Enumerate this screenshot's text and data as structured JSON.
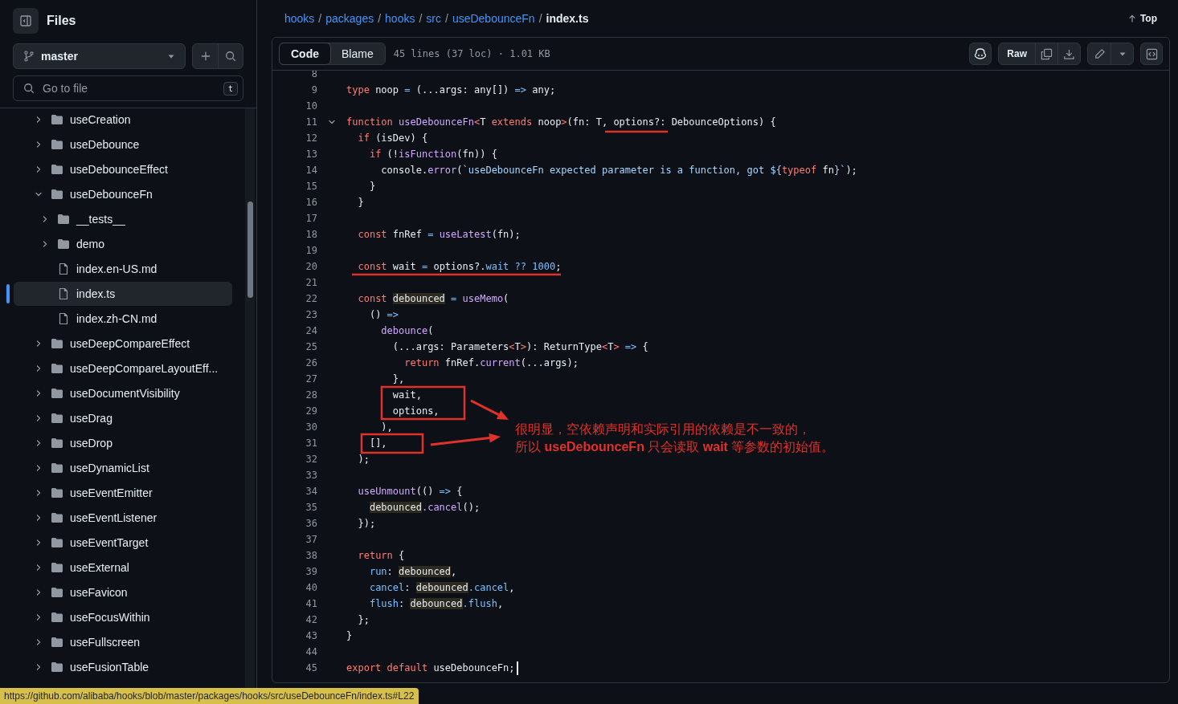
{
  "sidebar": {
    "title": "Files",
    "branch": "master",
    "search": {
      "placeholder": "Go to file",
      "shortcut": "t"
    },
    "tree": [
      {
        "label": "useCreation",
        "kind": "folder",
        "expanded": false,
        "selected": false
      },
      {
        "label": "useDebounce",
        "kind": "folder",
        "expanded": false,
        "selected": false
      },
      {
        "label": "useDebounceEffect",
        "kind": "folder",
        "expanded": false,
        "selected": false
      },
      {
        "label": "useDebounceFn",
        "kind": "folder",
        "expanded": true,
        "selected": false,
        "children": [
          {
            "label": "__tests__",
            "kind": "folder",
            "expanded": false,
            "selected": false
          },
          {
            "label": "demo",
            "kind": "folder",
            "expanded": false,
            "selected": false
          },
          {
            "label": "index.en-US.md",
            "kind": "file",
            "selected": false
          },
          {
            "label": "index.ts",
            "kind": "file",
            "selected": true
          },
          {
            "label": "index.zh-CN.md",
            "kind": "file",
            "selected": false
          }
        ]
      },
      {
        "label": "useDeepCompareEffect",
        "kind": "folder",
        "expanded": false,
        "selected": false
      },
      {
        "label": "useDeepCompareLayoutEff...",
        "kind": "folder",
        "expanded": false,
        "selected": false
      },
      {
        "label": "useDocumentVisibility",
        "kind": "folder",
        "expanded": false,
        "selected": false
      },
      {
        "label": "useDrag",
        "kind": "folder",
        "expanded": false,
        "selected": false
      },
      {
        "label": "useDrop",
        "kind": "folder",
        "expanded": false,
        "selected": false
      },
      {
        "label": "useDynamicList",
        "kind": "folder",
        "expanded": false,
        "selected": false
      },
      {
        "label": "useEventEmitter",
        "kind": "folder",
        "expanded": false,
        "selected": false
      },
      {
        "label": "useEventListener",
        "kind": "folder",
        "expanded": false,
        "selected": false
      },
      {
        "label": "useEventTarget",
        "kind": "folder",
        "expanded": false,
        "selected": false
      },
      {
        "label": "useExternal",
        "kind": "folder",
        "expanded": false,
        "selected": false
      },
      {
        "label": "useFavicon",
        "kind": "folder",
        "expanded": false,
        "selected": false
      },
      {
        "label": "useFocusWithin",
        "kind": "folder",
        "expanded": false,
        "selected": false
      },
      {
        "label": "useFullscreen",
        "kind": "folder",
        "expanded": false,
        "selected": false
      },
      {
        "label": "useFusionTable",
        "kind": "folder",
        "expanded": false,
        "selected": false
      }
    ]
  },
  "breadcrumb": [
    {
      "label": "hooks",
      "separator": "/"
    },
    {
      "label": "packages",
      "separator": "/"
    },
    {
      "label": "hooks",
      "separator": "/"
    },
    {
      "label": "src",
      "separator": "/"
    },
    {
      "label": "useDebounceFn",
      "separator": "/"
    },
    {
      "label": "index.ts"
    }
  ],
  "top_link": "Top",
  "toolbar": {
    "tabs": [
      {
        "label": "Code",
        "selected": true
      },
      {
        "label": "Blame",
        "selected": false
      }
    ],
    "file_info": "45 lines (37 loc) · 1.01 KB",
    "raw": "Raw"
  },
  "code": [
    {
      "n": "8"
    },
    {
      "n": "9",
      "tokens": [
        {
          "text": "type",
          "kind": "k"
        },
        {
          "text": " noop ",
          "kind": "p"
        },
        {
          "text": "=",
          "kind": "c"
        },
        {
          "text": " (...args: any[]) ",
          "kind": "p"
        },
        {
          "text": "=>",
          "kind": "c"
        },
        {
          "text": " any;",
          "kind": "p"
        }
      ]
    },
    {
      "n": "10"
    },
    {
      "n": "11",
      "fold": true,
      "tokens": [
        {
          "text": "function",
          "kind": "k"
        },
        {
          "text": " useDebounceFn",
          "kind": "f"
        },
        {
          "text": "<",
          "kind": "k"
        },
        {
          "text": "T ",
          "kind": "p"
        },
        {
          "text": "extends",
          "kind": "k"
        },
        {
          "text": " noop",
          "kind": "p"
        },
        {
          "text": ">",
          "kind": "k"
        },
        {
          "text": "(fn: T, options?: DebounceOptions) {",
          "kind": "p"
        }
      ]
    },
    {
      "n": "12",
      "tokens": [
        {
          "text": "  if",
          "kind": "k"
        },
        {
          "text": " (isDev) {",
          "kind": "p"
        }
      ]
    },
    {
      "n": "13",
      "tokens": [
        {
          "text": "    if",
          "kind": "k"
        },
        {
          "text": " (!",
          "kind": "p"
        },
        {
          "text": "isFunction",
          "kind": "f"
        },
        {
          "text": "(fn)) {",
          "kind": "p"
        }
      ]
    },
    {
      "n": "14",
      "tokens": [
        {
          "text": "      console.",
          "kind": "p"
        },
        {
          "text": "error",
          "kind": "f"
        },
        {
          "text": "(",
          "kind": "p"
        },
        {
          "text": "`useDebounceFn expected parameter is a function, got ${",
          "kind": "s"
        },
        {
          "text": "typeof",
          "kind": "k"
        },
        {
          "text": " fn",
          "kind": "p"
        },
        {
          "text": "}`",
          "kind": "s"
        },
        {
          "text": ");",
          "kind": "p"
        }
      ]
    },
    {
      "n": "15",
      "tokens": [
        {
          "text": "    }",
          "kind": "p"
        }
      ]
    },
    {
      "n": "16",
      "tokens": [
        {
          "text": "  }",
          "kind": "p"
        }
      ]
    },
    {
      "n": "17"
    },
    {
      "n": "18",
      "tokens": [
        {
          "text": "  const",
          "kind": "k"
        },
        {
          "text": " fnRef ",
          "kind": "p"
        },
        {
          "text": "=",
          "kind": "c"
        },
        {
          "text": " useLatest",
          "kind": "f"
        },
        {
          "text": "(fn);",
          "kind": "p"
        }
      ]
    },
    {
      "n": "19"
    },
    {
      "n": "20",
      "tokens": [
        {
          "text": "  const",
          "kind": "k"
        },
        {
          "text": " wait ",
          "kind": "p"
        },
        {
          "text": "=",
          "kind": "c"
        },
        {
          "text": " options?.",
          "kind": "p"
        },
        {
          "text": "wait ?? 1000",
          "kind": "c"
        },
        {
          "text": ";",
          "kind": "p"
        }
      ]
    },
    {
      "n": "21"
    },
    {
      "n": "22",
      "tokens": [
        {
          "text": "  const ",
          "kind": "k"
        },
        {
          "text": "debounced",
          "kind": "h"
        },
        {
          "text": " = ",
          "kind": "c"
        },
        {
          "text": "useMemo",
          "kind": "f"
        },
        {
          "text": "(",
          "kind": "p"
        }
      ]
    },
    {
      "n": "23",
      "tokens": [
        {
          "text": "    () ",
          "kind": "p"
        },
        {
          "text": "=>",
          "kind": "c"
        }
      ]
    },
    {
      "n": "24",
      "tokens": [
        {
          "text": "      debounce",
          "kind": "f"
        },
        {
          "text": "(",
          "kind": "p"
        }
      ]
    },
    {
      "n": "25",
      "tokens": [
        {
          "text": "        (...args: Parameters",
          "kind": "p"
        },
        {
          "text": "<",
          "kind": "k"
        },
        {
          "text": "T",
          "kind": "p"
        },
        {
          "text": ">",
          "kind": "k"
        },
        {
          "text": "): ReturnType",
          "kind": "p"
        },
        {
          "text": "<",
          "kind": "k"
        },
        {
          "text": "T",
          "kind": "p"
        },
        {
          "text": ">",
          "kind": "k"
        },
        {
          "text": " =>",
          "kind": "c"
        },
        {
          "text": " {",
          "kind": "p"
        }
      ]
    },
    {
      "n": "26",
      "tokens": [
        {
          "text": "          return",
          "kind": "k"
        },
        {
          "text": " fnRef.",
          "kind": "p"
        },
        {
          "text": "current",
          "kind": "f"
        },
        {
          "text": "(...args);",
          "kind": "p"
        }
      ]
    },
    {
      "n": "27",
      "tokens": [
        {
          "text": "        },",
          "kind": "p"
        }
      ]
    },
    {
      "n": "28",
      "tokens": [
        {
          "text": "        wait,",
          "kind": "p"
        }
      ]
    },
    {
      "n": "29",
      "tokens": [
        {
          "text": "        options,",
          "kind": "p"
        }
      ]
    },
    {
      "n": "30",
      "tokens": [
        {
          "text": "      ),",
          "kind": "p"
        }
      ]
    },
    {
      "n": "31",
      "tokens": [
        {
          "text": "    [],",
          "kind": "p"
        }
      ]
    },
    {
      "n": "32",
      "tokens": [
        {
          "text": "  );",
          "kind": "p"
        }
      ]
    },
    {
      "n": "33"
    },
    {
      "n": "34",
      "tokens": [
        {
          "text": "  useUnmount",
          "kind": "f"
        },
        {
          "text": "(() ",
          "kind": "p"
        },
        {
          "text": "=>",
          "kind": "c"
        },
        {
          "text": " {",
          "kind": "p"
        }
      ]
    },
    {
      "n": "35",
      "tokens": [
        {
          "text": "    debounced",
          "kind": "h"
        },
        {
          "text": ".cancel",
          "kind": "f"
        },
        {
          "text": "();",
          "kind": "p"
        }
      ]
    },
    {
      "n": "36",
      "tokens": [
        {
          "text": "  });",
          "kind": "p"
        }
      ]
    },
    {
      "n": "37"
    },
    {
      "n": "38",
      "tokens": [
        {
          "text": "  return",
          "kind": "k"
        },
        {
          "text": " {",
          "kind": "p"
        }
      ]
    },
    {
      "n": "39",
      "tokens": [
        {
          "text": "    run",
          "kind": "c"
        },
        {
          "text": ": ",
          "kind": "p"
        },
        {
          "text": "debounced",
          "kind": "h"
        },
        {
          "text": ",",
          "kind": "p"
        }
      ]
    },
    {
      "n": "40",
      "tokens": [
        {
          "text": "    cancel",
          "kind": "c"
        },
        {
          "text": ": ",
          "kind": "p"
        },
        {
          "text": "debounced",
          "kind": "h"
        },
        {
          "text": ".cancel",
          "kind": "c"
        },
        {
          "text": ",",
          "kind": "p"
        }
      ]
    },
    {
      "n": "41",
      "tokens": [
        {
          "text": "    flush",
          "kind": "c"
        },
        {
          "text": ": ",
          "kind": "p"
        },
        {
          "text": "debounced",
          "kind": "h"
        },
        {
          "text": ".flush",
          "kind": "c"
        },
        {
          "text": ",",
          "kind": "p"
        }
      ]
    },
    {
      "n": "42",
      "tokens": [
        {
          "text": "  };",
          "kind": "p"
        }
      ]
    },
    {
      "n": "43",
      "tokens": [
        {
          "text": "}",
          "kind": "p"
        }
      ]
    },
    {
      "n": "44"
    },
    {
      "n": "45",
      "cursor": true,
      "tokens": [
        {
          "text": "export default",
          "kind": "k"
        },
        {
          "text": " useDebounceFn;",
          "kind": "p"
        }
      ]
    }
  ],
  "annotation": {
    "lines": [
      "很明显，空依赖声明和实际引用的依赖是不一致的，",
      "所以 **useDebounceFn** 只会读取 **wait** 等参数的初始值。"
    ]
  },
  "status_url": "https://github.com/alibaba/hooks/blob/master/packages/hooks/src/useDebounceFn/index.ts#L22"
}
